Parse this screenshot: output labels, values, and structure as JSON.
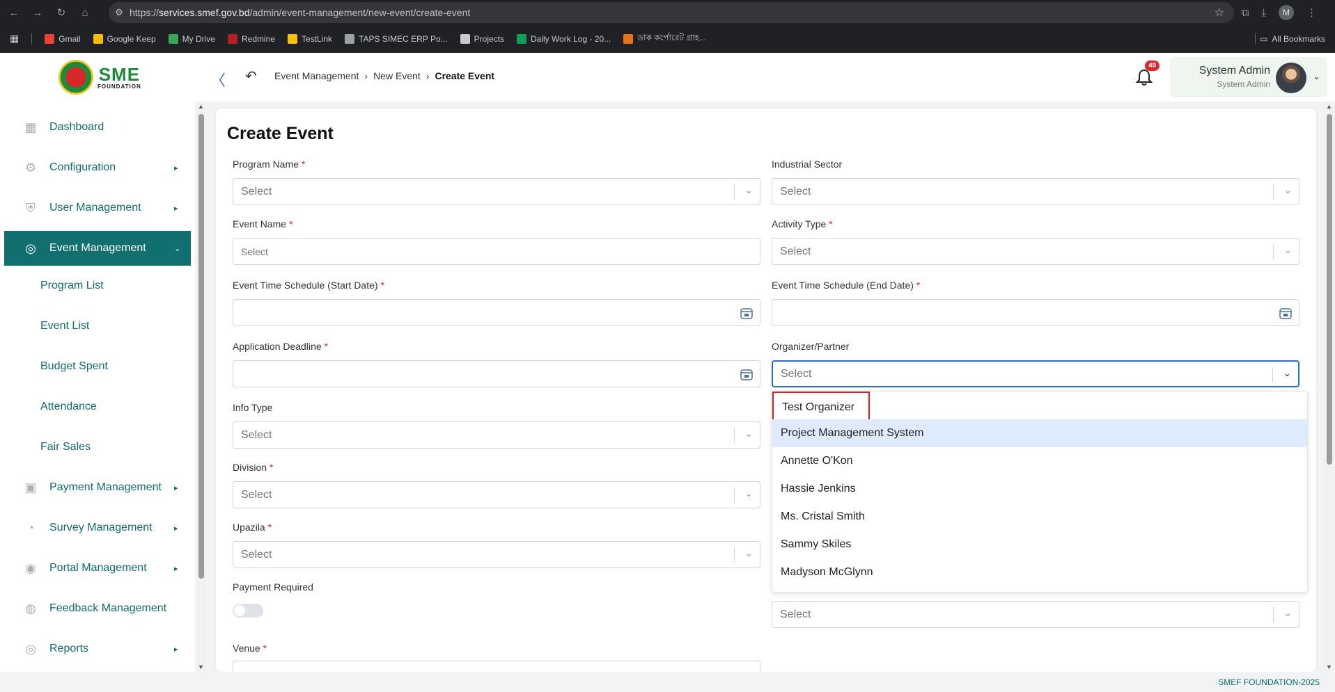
{
  "browser": {
    "url_host": "services.smef.gov.bd",
    "url_path": "/admin/event-management/new-event/create-event",
    "url_scheme": "https://",
    "profile_initial": "M",
    "bookmarks": [
      {
        "label": "Gmail",
        "color": "#ea4335"
      },
      {
        "label": "Google Keep",
        "color": "#fbbc04"
      },
      {
        "label": "My Drive",
        "color": "#34a853"
      },
      {
        "label": "Redmine",
        "color": "#b32024"
      },
      {
        "label": "TestLink",
        "color": "#f4c20d"
      },
      {
        "label": "TAPS SIMEC ERP Po...",
        "color": "#9aa0a6"
      },
      {
        "label": "Projects",
        "color": "#c8cacd"
      },
      {
        "label": "Daily Work Log - 20...",
        "color": "#0f9d58"
      },
      {
        "label": "ডাক কর্পোরেট গ্রাহ...",
        "color": "#e8711a"
      }
    ],
    "all_bookmarks": "All Bookmarks"
  },
  "header": {
    "logo_text": "SME",
    "logo_sub": "FOUNDATION",
    "breadcrumb": [
      "Event Management",
      "New Event",
      "Create Event"
    ],
    "notification_count": "49",
    "user_name": "System Admin",
    "user_role": "System Admin"
  },
  "sidebar": {
    "items": [
      {
        "label": "Dashboard",
        "icon": "grid-icon",
        "arrow": ""
      },
      {
        "label": "Configuration",
        "icon": "config-icon",
        "arrow": "▸"
      },
      {
        "label": "User Management",
        "icon": "user-shield-icon",
        "arrow": "▸"
      },
      {
        "label": "Event Management",
        "icon": "event-icon",
        "arrow": "⌄"
      }
    ],
    "sub_items": [
      "Program List",
      "Event List",
      "Budget Spent",
      "Attendance",
      "Fair Sales"
    ],
    "items_after": [
      {
        "label": "Payment Management",
        "icon": "payment-icon",
        "arrow": "▸"
      },
      {
        "label": "Survey Management",
        "icon": "pie-chart-icon",
        "arrow": "▸"
      },
      {
        "label": "Portal Management",
        "icon": "portal-icon",
        "arrow": "▸"
      },
      {
        "label": "Feedback Management",
        "icon": "feedback-icon",
        "arrow": ""
      },
      {
        "label": "Reports",
        "icon": "reports-icon",
        "arrow": "▸"
      }
    ]
  },
  "form": {
    "title": "Create Event",
    "program_name": {
      "label": "Program Name",
      "placeholder": "Select"
    },
    "industrial_sector": {
      "label": "Industrial Sector",
      "placeholder": "Select"
    },
    "event_name": {
      "label": "Event Name",
      "placeholder": "Select"
    },
    "activity_type": {
      "label": "Activity Type",
      "placeholder": "Select"
    },
    "start_date": {
      "label": "Event Time Schedule (Start Date)",
      "value": ""
    },
    "end_date": {
      "label": "Event Time Schedule (End Date)",
      "value": ""
    },
    "application_deadline": {
      "label": "Application Deadline",
      "value": ""
    },
    "organizer": {
      "label": "Organizer/Partner",
      "placeholder": "Select"
    },
    "info_type": {
      "label": "Info Type",
      "placeholder": "Select"
    },
    "division": {
      "label": "Division",
      "placeholder": "Select"
    },
    "upazila": {
      "label": "Upazila",
      "placeholder": "Select"
    },
    "payment_required": {
      "label": "Payment Required",
      "enabled": false
    },
    "right_lower_select": {
      "placeholder": "Select"
    },
    "venue": {
      "label": "Venue"
    },
    "required_mark": "*"
  },
  "organizer_options": [
    "Test Organizer",
    "Project Management System",
    "Annette O'Kon",
    "Hassie Jenkins",
    "Ms. Cristal Smith",
    "Sammy Skiles",
    "Madyson McGlynn"
  ],
  "footer": {
    "text": "SMEF FOUNDATION-2025"
  },
  "colors": {
    "primary": "#11706f",
    "required": "#d62828",
    "focus": "#2e6ec2",
    "highlight_box": "#e01e1e",
    "option_hover": "#deebff"
  }
}
